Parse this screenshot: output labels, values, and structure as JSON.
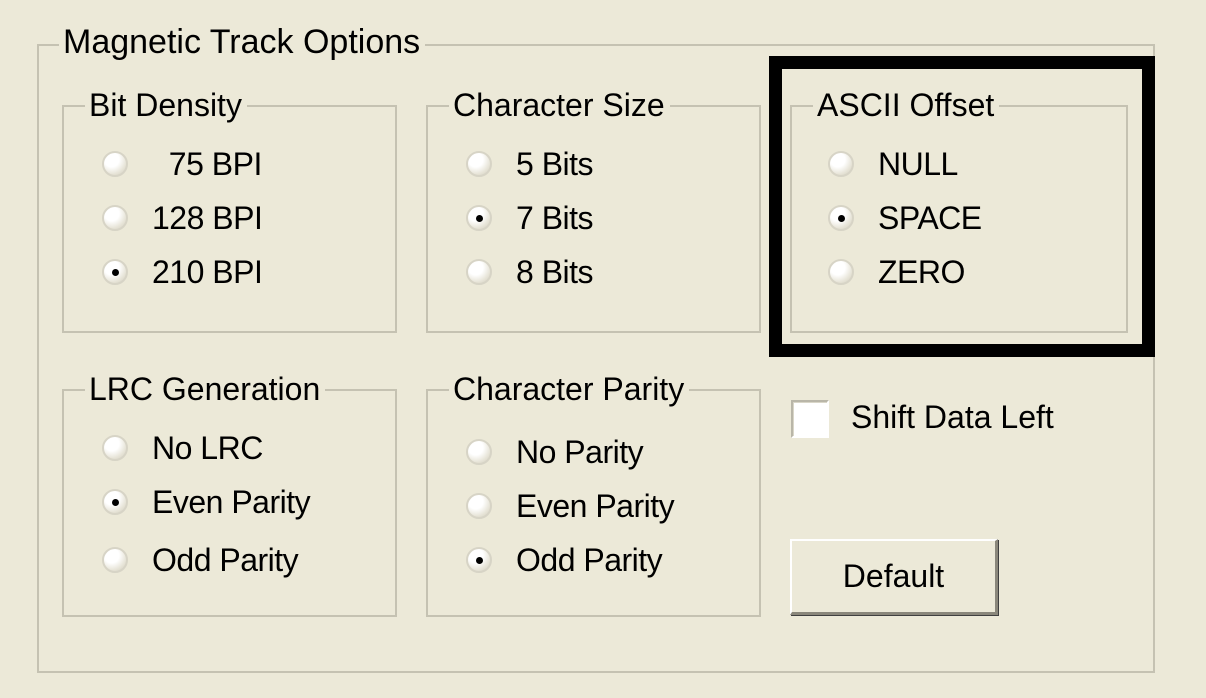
{
  "outer_group": {
    "label": "Magnetic Track Options"
  },
  "bit_density": {
    "label": "Bit Density",
    "options": [
      {
        "label": "  75 BPI",
        "checked": false
      },
      {
        "label": "128 BPI",
        "checked": false
      },
      {
        "label": "210 BPI",
        "checked": true
      }
    ]
  },
  "character_size": {
    "label": "Character Size",
    "options": [
      {
        "label": "5 Bits",
        "checked": false
      },
      {
        "label": "7 Bits",
        "checked": true
      },
      {
        "label": "8 Bits",
        "checked": false
      }
    ]
  },
  "ascii_offset": {
    "label": "ASCII Offset",
    "options": [
      {
        "label": "NULL",
        "checked": false
      },
      {
        "label": "SPACE",
        "checked": true
      },
      {
        "label": "ZERO",
        "checked": false
      }
    ]
  },
  "lrc_generation": {
    "label": "LRC Generation",
    "options": [
      {
        "label": "No LRC",
        "checked": false
      },
      {
        "label": "Even Parity",
        "checked": true
      },
      {
        "label": "Odd Parity",
        "checked": false
      }
    ]
  },
  "character_parity": {
    "label": "Character Parity",
    "options": [
      {
        "label": "No Parity",
        "checked": false
      },
      {
        "label": "Even Parity",
        "checked": false
      },
      {
        "label": "Odd Parity",
        "checked": true
      }
    ]
  },
  "shift_data_left": {
    "label": "Shift Data Left",
    "checked": false
  },
  "default_button": {
    "label": "Default"
  },
  "colors": {
    "background": "#ECE9D8",
    "group_border": "#C5C2B2",
    "highlight": "#000000"
  }
}
